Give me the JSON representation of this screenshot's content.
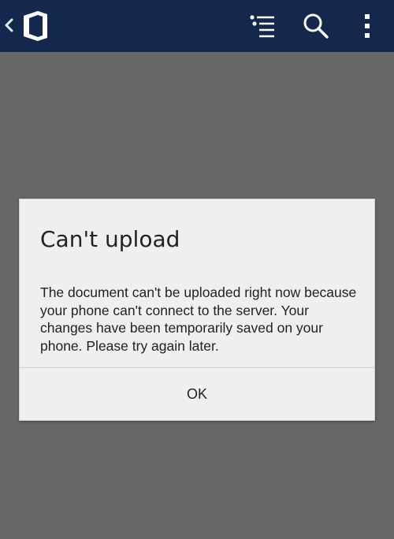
{
  "action_bar": {
    "back_icon": "chevron-left-icon",
    "logo_icon": "office-logo-icon",
    "actions": [
      "outline-list-icon",
      "search-icon",
      "more-vert-icon"
    ],
    "color": "#13284c"
  },
  "dialog": {
    "title": "Can't upload",
    "message": "The document can't be uploaded right now because your phone can't connect to the server. Your changes have been temporarily saved on your phone. Please try again later.",
    "ok_label": "OK"
  },
  "colors": {
    "scrim": "#676767",
    "dialog_background": "#efefef"
  }
}
